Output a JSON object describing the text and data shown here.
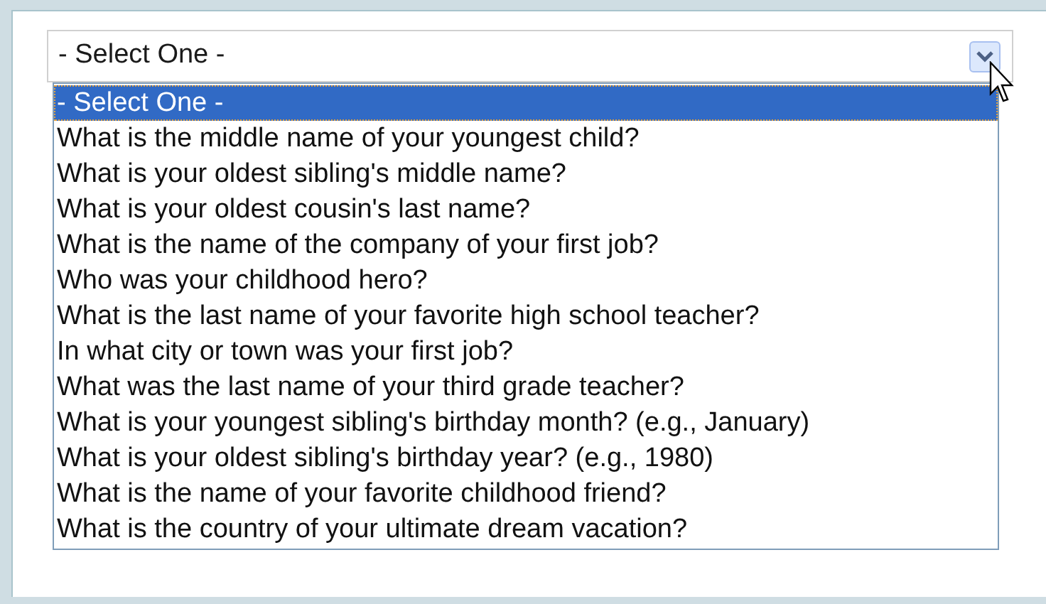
{
  "select": {
    "value": "- Select One -",
    "expanded": true
  },
  "options": [
    {
      "label": "- Select One -",
      "selected": true
    },
    {
      "label": "What is the middle name of your youngest child?",
      "selected": false
    },
    {
      "label": "What is your oldest sibling's middle name?",
      "selected": false
    },
    {
      "label": "What is your oldest cousin's last name?",
      "selected": false
    },
    {
      "label": "What is the name of the company of your first job?",
      "selected": false
    },
    {
      "label": "Who was your childhood hero?",
      "selected": false
    },
    {
      "label": "What is the last name of your favorite high school teacher?",
      "selected": false
    },
    {
      "label": "In what city or town was your first job?",
      "selected": false
    },
    {
      "label": "What was the last name of your third grade teacher?",
      "selected": false
    },
    {
      "label": "What is your youngest sibling's birthday month? (e.g., January)",
      "selected": false
    },
    {
      "label": "What is your oldest sibling's birthday year? (e.g., 1980)",
      "selected": false
    },
    {
      "label": "What is the name of your favorite childhood friend?",
      "selected": false
    },
    {
      "label": "What is the country of your ultimate dream vacation?",
      "selected": false
    }
  ]
}
